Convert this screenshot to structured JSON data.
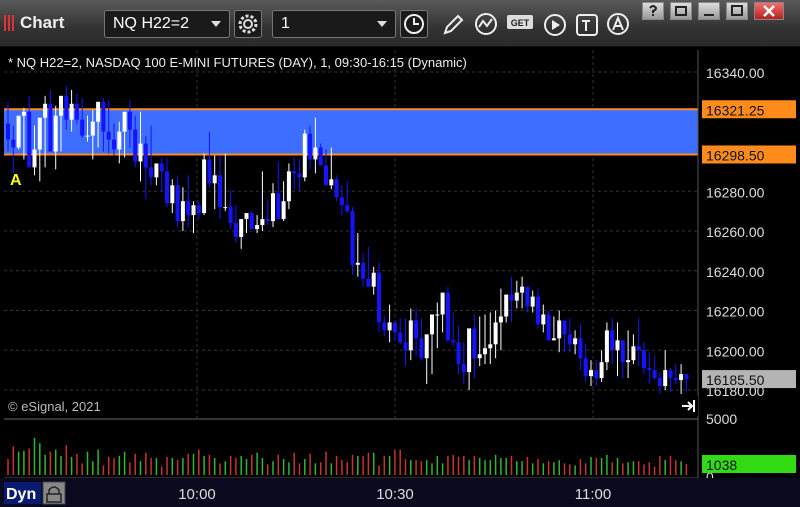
{
  "toolbar": {
    "title": "Chart",
    "symbol": "NQ H22=2",
    "interval": "1",
    "tools": [
      "clock-icon",
      "pencil-icon",
      "chart-line-icon",
      "get-icon",
      "play-icon",
      "text-cursor-icon",
      "alert-icon"
    ],
    "get_label": "GET"
  },
  "window_buttons": [
    "help-button",
    "restore-button",
    "maximize-button",
    "close-button"
  ],
  "chart_header": "* NQ H22=2, NASDAQ 100 E-MINI FUTURES (DAY), 1, 09:30-16:15 (Dynamic)",
  "watermark": "© eSignal, 2021",
  "marker_label": "A",
  "bottom_bar": {
    "dyn_label": "Dyn"
  },
  "colors": {
    "up": "#ffffff",
    "down": "#1414ff",
    "band": "#3e6eff",
    "level_line": "#ff8c1a",
    "last_price_bg": "#b4b4b4",
    "volume_label_bg": "#32dc14",
    "vol_up": "#2db82d",
    "vol_down": "#c83232",
    "grid": "#333333",
    "axis_text": "#dddddd"
  },
  "chart_data": {
    "type": "candlestick",
    "price_axis": {
      "ticks": [
        "16340.00",
        "16320.00",
        "16300.00",
        "16280.00",
        "16260.00",
        "16240.00",
        "16220.00",
        "16200.00",
        "16180.00"
      ],
      "range": [
        16175,
        16345
      ]
    },
    "time_axis": {
      "ticks": [
        "10:00",
        "10:30",
        "11:00"
      ]
    },
    "levels": [
      {
        "label": "16321.25",
        "value": 16321.25
      },
      {
        "label": "16298.50",
        "value": 16298.5
      }
    ],
    "last_price": {
      "label": "16185.50",
      "value": 16185.5
    },
    "volume": {
      "axis_top_label": "5000",
      "axis_bottom_label": "0",
      "last_label": "1038",
      "max": 5000
    },
    "candles": {
      "open": [
        16314,
        16306,
        16302,
        16318,
        16320,
        16292,
        16301,
        16317,
        16324,
        16300,
        16318,
        16328,
        16316,
        16324,
        16316,
        16308,
        16308,
        16315,
        16325,
        16310,
        16306,
        16301,
        16310,
        16320,
        16311,
        16295,
        16304,
        16292,
        16287,
        16294,
        16290,
        16274,
        16283,
        16265,
        16275,
        16268,
        16273,
        16269,
        16296,
        16284,
        16288,
        16272,
        16272,
        16264,
        16257,
        16266,
        16269,
        16261,
        16263,
        16266,
        16265,
        16279,
        16266,
        16275,
        16290,
        16289,
        16287,
        16309,
        16296,
        16302,
        16293,
        16283,
        16286,
        16277,
        16273,
        16270,
        16243,
        16244,
        16236,
        16232,
        16239,
        16214,
        16210,
        16214,
        16209,
        16204,
        16200,
        16215,
        16206,
        16196,
        16208,
        16218,
        16218,
        16229,
        16205,
        16204,
        16193,
        16189,
        16211,
        16196,
        16198,
        16201,
        16203,
        16214,
        16217,
        16228,
        16225,
        16229,
        16232,
        16222,
        16227,
        16213,
        16218,
        16205,
        16206,
        16215,
        16208,
        16203,
        16206,
        16196,
        16187,
        16190,
        16186,
        16194,
        16210,
        16200,
        16205,
        16194,
        16195,
        16202,
        16200,
        16191,
        16190,
        16186,
        16182,
        16190,
        16186,
        16185,
        16188
      ],
      "high": [
        16325,
        16313,
        16313,
        16322,
        16328,
        16313,
        16306,
        16328,
        16331,
        16323,
        16328,
        16333,
        16331,
        16329,
        16327,
        16318,
        16321,
        16323,
        16327,
        16326,
        16314,
        16315,
        16315,
        16326,
        16318,
        16320,
        16308,
        16313,
        16293,
        16297,
        16297,
        16286,
        16288,
        16282,
        16288,
        16275,
        16275,
        16299,
        16310,
        16298,
        16298,
        16299,
        16281,
        16273,
        16264,
        16269,
        16270,
        16268,
        16290,
        16276,
        16284,
        16295,
        16285,
        16294,
        16297,
        16296,
        16311,
        16313,
        16317,
        16304,
        16301,
        16302,
        16288,
        16283,
        16285,
        16272,
        16259,
        16249,
        16252,
        16242,
        16244,
        16217,
        16223,
        16214,
        16216,
        16216,
        16221,
        16221,
        16216,
        16205,
        16216,
        16224,
        16225,
        16232,
        16219,
        16212,
        16204,
        16200,
        16218,
        16217,
        16218,
        16219,
        16220,
        16231,
        16228,
        16237,
        16235,
        16237,
        16231,
        16230,
        16231,
        16223,
        16220,
        16217,
        16220,
        16215,
        16216,
        16210,
        16213,
        16203,
        16195,
        16195,
        16200,
        16214,
        16216,
        16214,
        16205,
        16210,
        16208,
        16216,
        16204,
        16199,
        16197,
        16189,
        16200,
        16191,
        16193,
        16193,
        16188
      ],
      "low": [
        16300,
        16289,
        16301,
        16296,
        16298,
        16288,
        16285,
        16292,
        16312,
        16291,
        16300,
        16311,
        16310,
        16314,
        16307,
        16305,
        16296,
        16302,
        16300,
        16299,
        16298,
        16294,
        16297,
        16302,
        16292,
        16285,
        16276,
        16283,
        16283,
        16280,
        16272,
        16269,
        16262,
        16260,
        16262,
        16259,
        16266,
        16268,
        16282,
        16271,
        16266,
        16270,
        16261,
        16254,
        16251,
        16259,
        16264,
        16259,
        16260,
        16263,
        16262,
        16267,
        16265,
        16271,
        16281,
        16280,
        16285,
        16291,
        16289,
        16296,
        16285,
        16281,
        16275,
        16268,
        16269,
        16238,
        16237,
        16232,
        16234,
        16228,
        16209,
        16207,
        16204,
        16205,
        16203,
        16192,
        16195,
        16197,
        16195,
        16183,
        16188,
        16201,
        16209,
        16204,
        16202,
        16188,
        16183,
        16180,
        16186,
        16192,
        16193,
        16193,
        16196,
        16200,
        16214,
        16214,
        16221,
        16221,
        16219,
        16219,
        16211,
        16209,
        16205,
        16205,
        16199,
        16199,
        16199,
        16198,
        16190,
        16184,
        16182,
        16182,
        16184,
        16190,
        16193,
        16187,
        16186,
        16186,
        16193,
        16192,
        16188,
        16183,
        16185,
        16178,
        16180,
        16179,
        16183,
        16178,
        16179
      ],
      "close": [
        16306,
        16302,
        16318,
        16320,
        16292,
        16301,
        16317,
        16324,
        16300,
        16318,
        16328,
        16316,
        16324,
        16316,
        16308,
        16308,
        16315,
        16325,
        16310,
        16306,
        16301,
        16310,
        16320,
        16311,
        16295,
        16304,
        16292,
        16287,
        16294,
        16290,
        16274,
        16283,
        16265,
        16275,
        16268,
        16273,
        16269,
        16296,
        16284,
        16288,
        16272,
        16272,
        16264,
        16257,
        16266,
        16269,
        16261,
        16263,
        16266,
        16265,
        16279,
        16266,
        16275,
        16290,
        16289,
        16287,
        16309,
        16296,
        16302,
        16293,
        16283,
        16286,
        16277,
        16273,
        16270,
        16243,
        16244,
        16236,
        16232,
        16239,
        16214,
        16210,
        16214,
        16209,
        16204,
        16200,
        16215,
        16206,
        16196,
        16208,
        16218,
        16218,
        16229,
        16205,
        16204,
        16193,
        16189,
        16211,
        16196,
        16198,
        16201,
        16203,
        16214,
        16217,
        16228,
        16225,
        16229,
        16232,
        16222,
        16227,
        16213,
        16218,
        16205,
        16206,
        16215,
        16208,
        16203,
        16206,
        16196,
        16187,
        16190,
        16186,
        16194,
        16210,
        16200,
        16205,
        16194,
        16195,
        16202,
        16200,
        16191,
        16190,
        16186,
        16182,
        16190,
        16186,
        16185,
        16188,
        16185.5
      ],
      "volume": [
        1500,
        2700,
        2200,
        2300,
        2500,
        3500,
        3000,
        1900,
        2200,
        2400,
        1800,
        2800,
        1700,
        2000,
        1100,
        2200,
        1300,
        2400,
        900,
        1700,
        1600,
        1800,
        2200,
        1200,
        2000,
        1300,
        2100,
        1600,
        1600,
        800,
        1700,
        1600,
        1400,
        1600,
        2000,
        2000,
        2400,
        1800,
        1900,
        1600,
        1100,
        1300,
        1800,
        1600,
        1800,
        1500,
        1900,
        2100,
        1600,
        1000,
        1300,
        1900,
        1500,
        1200,
        2100,
        1100,
        1500,
        2000,
        1100,
        1200,
        2200,
        1100,
        1800,
        1400,
        1200,
        1900,
        1800,
        1800,
        2100,
        2100,
        900,
        1800,
        1800,
        2400,
        2400,
        1500,
        1400,
        1400,
        1300,
        1400,
        1100,
        1800,
        1100,
        1800,
        1900,
        1700,
        1800,
        1400,
        1800,
        1600,
        1400,
        1400,
        1900,
        1600,
        1600,
        1800,
        1300,
        1300,
        1700,
        1100,
        1500,
        1100,
        1300,
        1200,
        1400,
        1100,
        1000,
        900,
        1500,
        1100,
        1700,
        1600,
        1600,
        1900,
        1200,
        1600,
        1100,
        1200,
        1300,
        1300,
        1000,
        1200,
        800,
        1800,
        1400,
        1800,
        1400,
        1300,
        1038
      ]
    }
  }
}
